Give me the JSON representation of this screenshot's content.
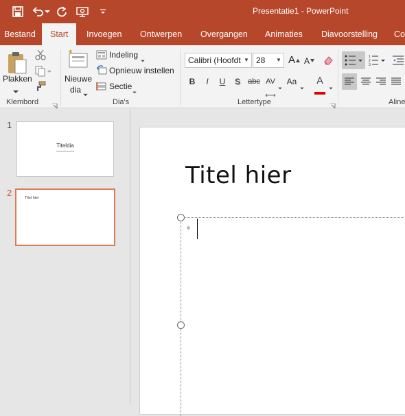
{
  "window": {
    "title": "Presentatie1 - PowerPoint"
  },
  "qat": {
    "icons": [
      "save-icon",
      "undo-icon",
      "redo-icon",
      "present-icon",
      "customize-icon"
    ]
  },
  "tabs": [
    {
      "label": "Bestand",
      "active": false
    },
    {
      "label": "Start",
      "active": true
    },
    {
      "label": "Invoegen",
      "active": false
    },
    {
      "label": "Ontwerpen",
      "active": false
    },
    {
      "label": "Overgangen",
      "active": false
    },
    {
      "label": "Animaties",
      "active": false
    },
    {
      "label": "Diavoorstelling",
      "active": false
    },
    {
      "label": "Co",
      "active": false
    }
  ],
  "ribbon": {
    "klembord": {
      "label": "Klembord",
      "paste_label": "Plakken"
    },
    "dias": {
      "label": "Dia's",
      "new_slide_line1": "Nieuwe",
      "new_slide_line2": "dia",
      "layout": "Indeling",
      "reset": "Opnieuw instellen",
      "section": "Sectie"
    },
    "lettertype": {
      "label": "Lettertype",
      "font": "Calibri (Hoofdt",
      "size": "28",
      "bold": "B",
      "italic": "I",
      "underline": "U",
      "shadow": "S",
      "strike": "abc",
      "spacing": "AV",
      "case": "Aa",
      "fontcolor": "A",
      "grow": "A",
      "shrink": "A"
    },
    "alinea": {
      "label": "Aline"
    }
  },
  "slides": [
    {
      "number": "1",
      "title": "Titeldia"
    },
    {
      "number": "2",
      "title": "Titel hier"
    }
  ],
  "editor": {
    "title": "Titel hier"
  },
  "colors": {
    "accent": "#b7472a",
    "selection": "#e07a55",
    "font_color_bar": "#e00000"
  }
}
